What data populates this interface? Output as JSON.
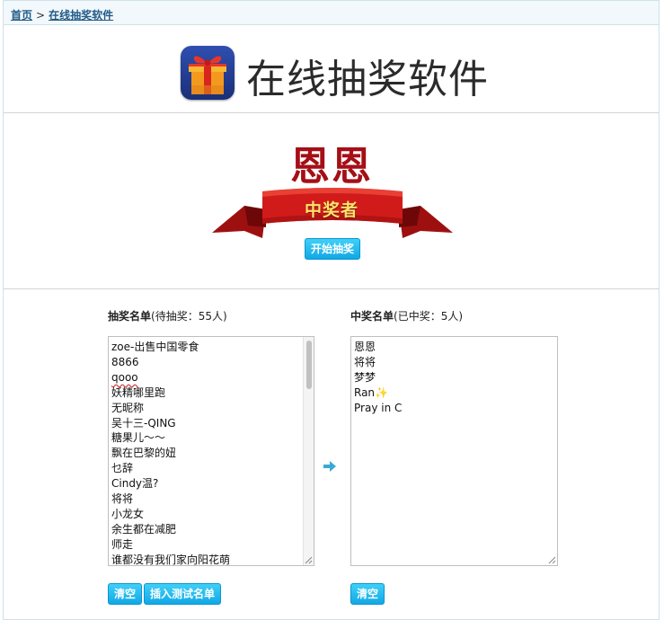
{
  "breadcrumb": {
    "home": "首页",
    "separator": ">",
    "current": "在线抽奖软件"
  },
  "header": {
    "title": "在线抽奖软件",
    "icon": "gift-box-icon"
  },
  "winner": {
    "name": "恩恩",
    "ribbon_label": "中奖者",
    "start_button": "开始抽奖"
  },
  "pending": {
    "title": "抽奖名单",
    "meta": "(待抽奖：55人)",
    "items": [
      "zoe-出售中国零食",
      "8866",
      "qooo",
      "妖精哪里跑",
      "无昵称",
      "吴十三-QING",
      "糖果儿～～",
      "飘在巴黎的妞",
      "乜辞",
      "Cindy温?",
      "将将",
      "小龙女",
      "余生都在减肥",
      "师走",
      "谁都没有我们家向阳花萌"
    ],
    "clear_button": "清空",
    "insert_button": "插入测试名单"
  },
  "winners": {
    "title": "中奖名单",
    "meta": "(已中奖：5人)",
    "items": [
      "恩恩",
      "将将",
      "梦梦",
      "Ran",
      "Pray in C"
    ],
    "sparkle": "✨",
    "clear_button": "清空"
  },
  "colors": {
    "accent": "#15aee9",
    "winner_red": "#a50f16",
    "link": "#1f5a87"
  }
}
